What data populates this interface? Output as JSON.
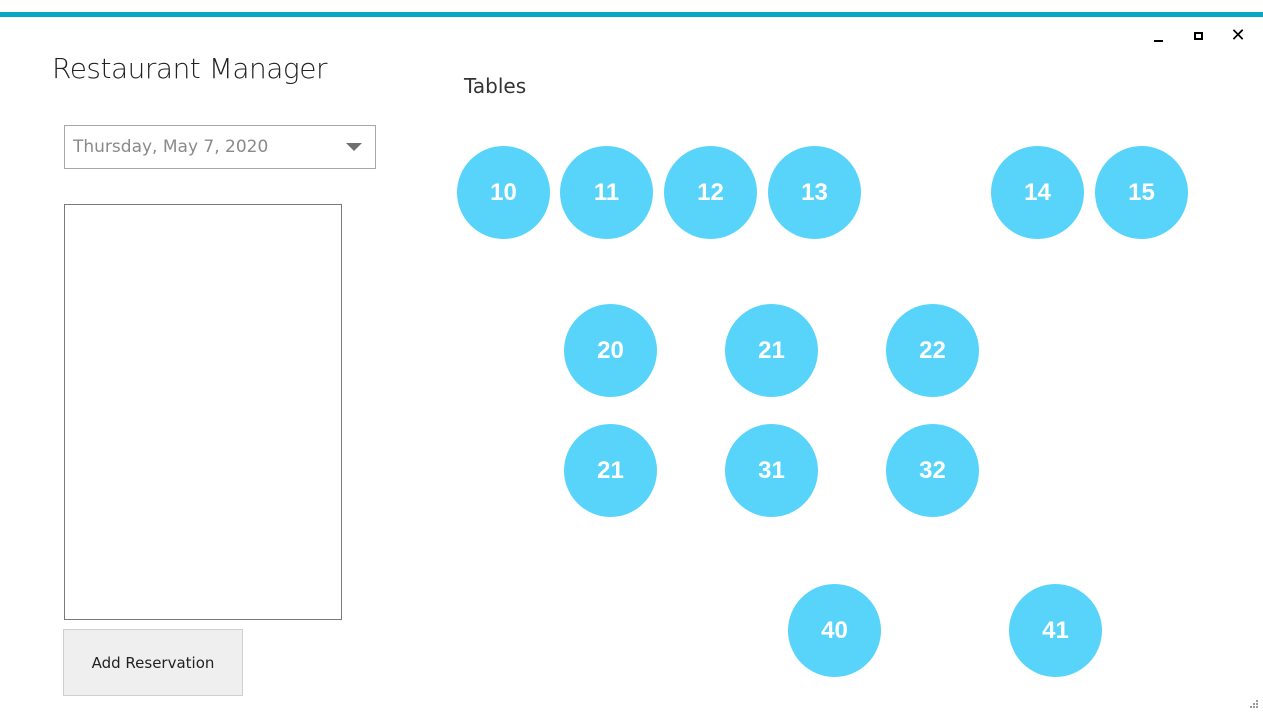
{
  "window": {
    "accent_color": "#0aa6c8",
    "controls": {
      "minimize": "_",
      "maximize": "□",
      "close": "✕"
    }
  },
  "header": {
    "app_title": "Restaurant Manager",
    "tables_title": "Tables"
  },
  "sidebar": {
    "date_picker": {
      "value": "Thursday, May 7, 2020",
      "icon": "chevron-down-icon"
    },
    "reservations": [],
    "add_button_label": "Add Reservation"
  },
  "tables": {
    "color": "#58d4fb",
    "items": [
      {
        "label": "10"
      },
      {
        "label": "11"
      },
      {
        "label": "12"
      },
      {
        "label": "13"
      },
      {
        "label": "14"
      },
      {
        "label": "15"
      },
      {
        "label": "20"
      },
      {
        "label": "21"
      },
      {
        "label": "22"
      },
      {
        "label": "21"
      },
      {
        "label": "31"
      },
      {
        "label": "32"
      },
      {
        "label": "40"
      },
      {
        "label": "41"
      }
    ]
  }
}
